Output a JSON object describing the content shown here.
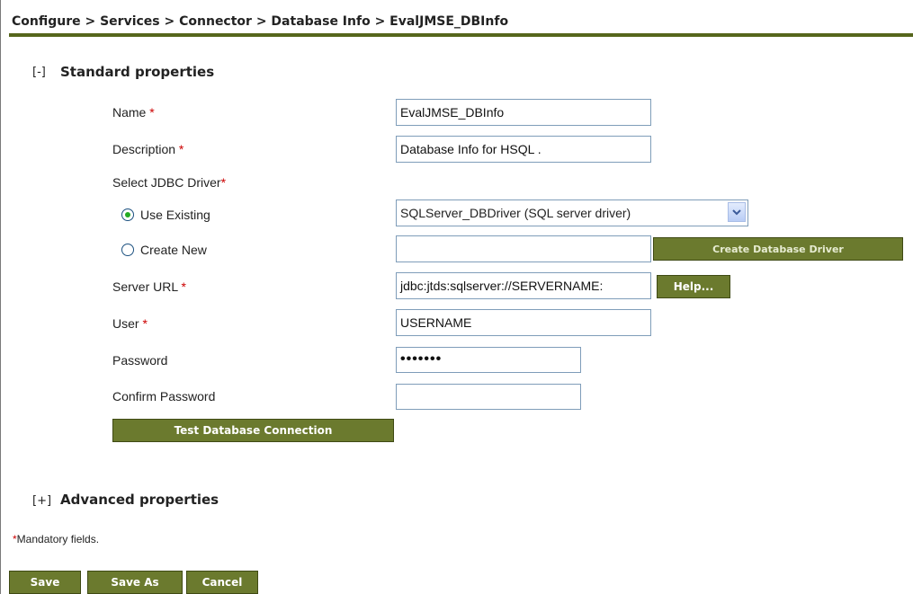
{
  "breadcrumb": "Configure > Services > Connector > Database Info > EvalJMSE_DBInfo",
  "standard_section": {
    "toggle": "[-]",
    "title": "Standard properties"
  },
  "form": {
    "name_label": "Name",
    "name_value": "EvalJMSE_DBInfo",
    "description_label": "Description",
    "description_value": "Database Info for HSQL .",
    "jdbc_label": "Select JDBC Driver",
    "use_existing_label": "Use Existing",
    "use_existing_selected": true,
    "driver_selected": "SQLServer_DBDriver (SQL server driver)",
    "create_new_label": "Create New",
    "create_new_value": "",
    "create_driver_button": "Create Database Driver",
    "server_url_label": "Server URL",
    "server_url_value": "jdbc:jtds:sqlserver://SERVERNAME:",
    "help_button": "Help...",
    "user_label": "User",
    "user_value": "USERNAME",
    "password_label": "Password",
    "password_value": "•••••••",
    "confirm_password_label": "Confirm Password",
    "confirm_password_value": "",
    "test_connection_button": "Test Database Connection",
    "required_marker": "*"
  },
  "advanced_section": {
    "toggle": "[+]",
    "title": "Advanced properties"
  },
  "mandatory_note": {
    "marker": "*",
    "text": "Mandatory fields."
  },
  "footer_buttons": {
    "save": "Save",
    "save_as": "Save As",
    "cancel": "Cancel"
  },
  "colors": {
    "accent": "#56661c",
    "button": "#6b7a2e",
    "required": "#cc0000"
  },
  "icons": {
    "select_arrow": "chevron-down-icon"
  }
}
